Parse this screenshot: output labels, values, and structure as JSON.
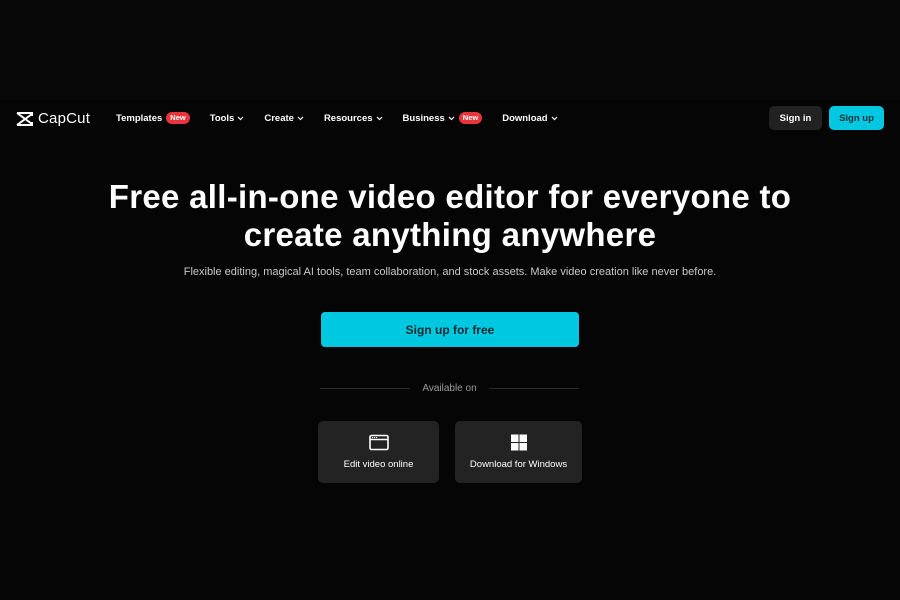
{
  "brand": {
    "name": "CapCut"
  },
  "nav": {
    "items": [
      {
        "label": "Templates",
        "badge": "New",
        "dropdown": false
      },
      {
        "label": "Tools",
        "dropdown": true
      },
      {
        "label": "Create",
        "dropdown": true
      },
      {
        "label": "Resources",
        "dropdown": true
      },
      {
        "label": "Business",
        "badge": "New",
        "dropdown": true
      },
      {
        "label": "Download",
        "dropdown": true
      }
    ],
    "sign_in": "Sign in",
    "sign_up": "Sign up"
  },
  "hero": {
    "title_line1": "Free all-in-one video editor for everyone to",
    "title_line2": "create anything anywhere",
    "subtitle": "Flexible editing, magical AI tools, team collaboration, and stock assets. Make video creation like never before.",
    "cta": "Sign up for free",
    "available_on": "Available on",
    "platforms": [
      {
        "label": "Edit video online",
        "icon": "browser-window-icon"
      },
      {
        "label": "Download for Windows",
        "icon": "windows-icon"
      }
    ]
  },
  "colors": {
    "accent": "#00c8e0",
    "badge": "#e8343a",
    "background": "#050505",
    "card": "#232323"
  }
}
